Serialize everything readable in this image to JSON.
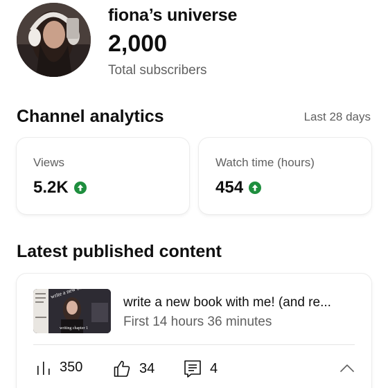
{
  "channel": {
    "name": "fiona’s universe",
    "subscribers": "2,000",
    "subscribers_label": "Total subscribers"
  },
  "analytics": {
    "title": "Channel analytics",
    "range": "Last 28 days",
    "metrics": [
      {
        "label": "Views",
        "value": "5.2K",
        "trend": "up"
      },
      {
        "label": "Watch time (hours)",
        "value": "454",
        "trend": "up"
      }
    ]
  },
  "latest": {
    "title": "Latest published content",
    "video": {
      "title": "write a new book with me! (and re...",
      "subtitle": "First 14 hours 36 minutes",
      "thumbnail_text": "write a new book with me",
      "thumbnail_caption": "writing chapter 1",
      "views": "350",
      "likes": "34",
      "comments": "4"
    }
  },
  "colors": {
    "trend_up": "#1e8e3e",
    "text_primary": "#0f0f0f",
    "text_secondary": "#606060"
  },
  "icons": {
    "trend": "arrow-up-circle-icon",
    "views": "bar-chart-icon",
    "likes": "thumbs-up-icon",
    "comments": "comment-icon",
    "expand": "chevron-up-icon"
  }
}
